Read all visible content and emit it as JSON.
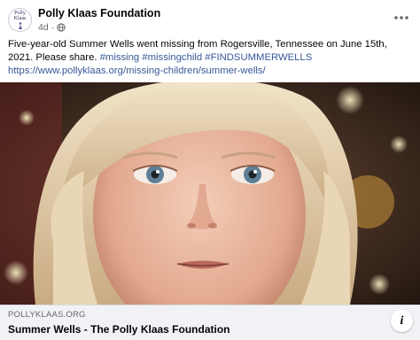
{
  "post": {
    "page_name": "Polly Klaas Foundation",
    "avatar_text": [
      "Polly",
      "Klaas"
    ],
    "time": "4d",
    "privacy_icon": "globe-icon",
    "more_icon": "more-options-icon",
    "text_main": "Five-year-old Summer Wells went missing from Rogersville, Tennessee on June 15th, 2021. Please share. ",
    "hashtags": [
      "#missing",
      "#missingchild",
      "#FINDSUMMERWELLS"
    ],
    "url": "https://www.pollyklaas.org/missing-children/summer-wells/"
  },
  "link_preview": {
    "domain": "POLLYKLAAS.ORG",
    "title": "Summer Wells - The Polly Klaas Foundation",
    "info_icon": "info-icon"
  },
  "colors": {
    "link": "#385898",
    "secondary_text": "#65676b",
    "preview_bg": "#f0f2f5"
  }
}
